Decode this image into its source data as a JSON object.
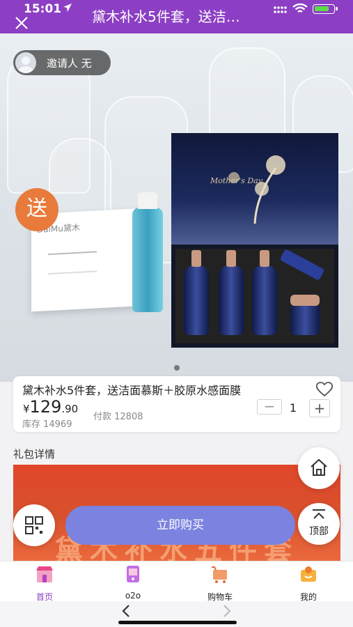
{
  "status": {
    "time": "15:01"
  },
  "header": {
    "title": "黛木补水5件套，送洁…"
  },
  "hero": {
    "inviter_label": "邀请人 无",
    "gift_badge": "送",
    "box_brand": "DaiMu黛木",
    "gift_text": "Mother's Day"
  },
  "product": {
    "title": "黛木补水5件套，送洁面慕斯＋胶原水感面膜",
    "price_currency": "¥",
    "price_int": "129",
    "price_dec": ".90",
    "stock": "库存 14969",
    "paid": "付款 12808",
    "quantity": "1",
    "minus": "−",
    "plus": "+"
  },
  "details": {
    "label": "礼包详情",
    "banner_text": "黛木补水五件套"
  },
  "actions": {
    "buy": "立即购买",
    "top": "顶部"
  },
  "tabs": [
    {
      "label": "首页",
      "icon": "shop-icon",
      "active": true
    },
    {
      "label": "o2o",
      "icon": "store-icon",
      "active": false
    },
    {
      "label": "购物车",
      "icon": "cart-icon",
      "active": false
    },
    {
      "label": "我的",
      "icon": "user-icon",
      "active": false
    }
  ],
  "colors": {
    "brand": "#8c3fc4",
    "buy": "#7b82df",
    "banner": "#e0462a"
  }
}
